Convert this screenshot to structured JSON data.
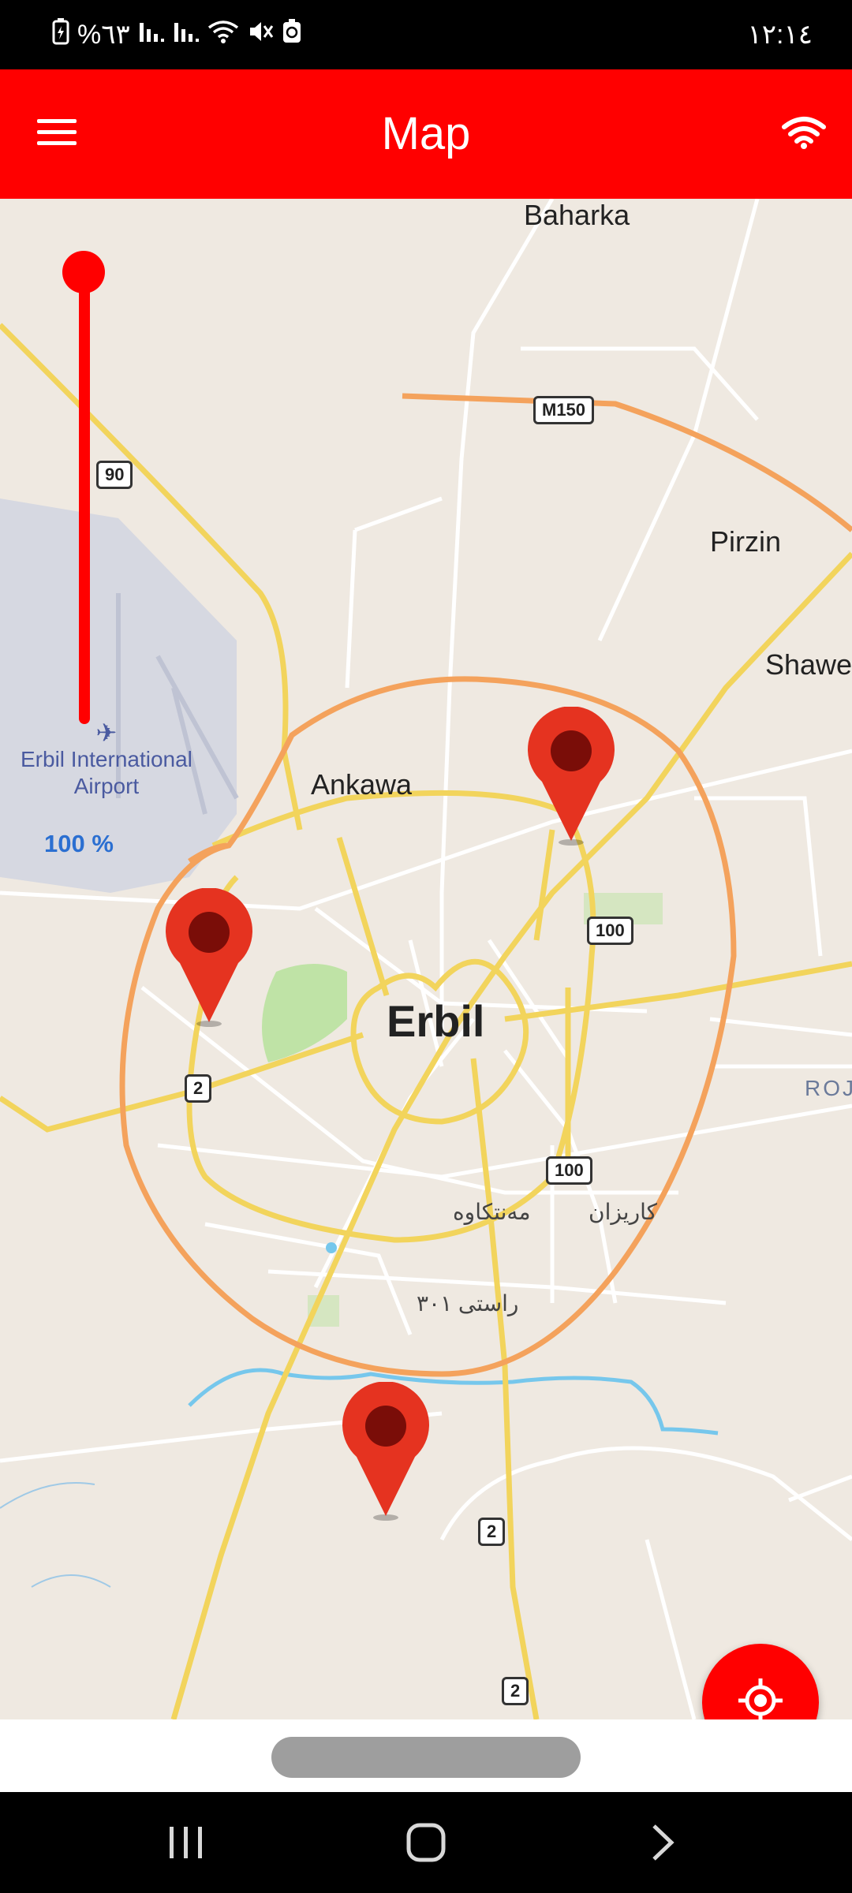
{
  "status_bar": {
    "battery_text": "%٦٣",
    "time": "١٢:١٤"
  },
  "app_bar": {
    "title": "Map"
  },
  "map": {
    "places": [
      "Baharka",
      "Pirzin",
      "Shawe",
      "Ankawa",
      "Erbil",
      "ROJ"
    ],
    "airport": [
      "Erbil International",
      "Airport"
    ],
    "districts": [
      "مەنتكاوە",
      "كاریزان",
      "راستی ٣٠١"
    ],
    "roads": [
      "90",
      "M150",
      "100",
      "100",
      "2",
      "2",
      "2"
    ]
  },
  "slider": {
    "value_text": "100 %",
    "level_percent": 100
  },
  "colors": {
    "accent": "#ff0000",
    "map_bg": "#efe9e1",
    "major_road": "#f2d45c",
    "ring_road": "#f4a25c",
    "slider_value": "#2b6fd1"
  },
  "icons": {
    "menu": "menu-icon",
    "wifi": "wifi-icon",
    "locate": "my-location-icon",
    "pin": "map-pin-icon"
  }
}
